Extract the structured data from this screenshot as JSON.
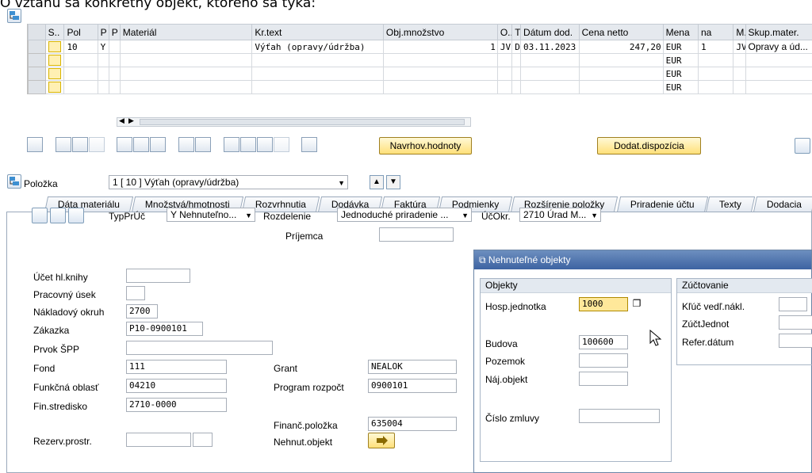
{
  "caption": "O vzťahu sa konkrétny objekt, ktorého sa týka:",
  "grid": {
    "headers": [
      "S..",
      "Pol",
      "P",
      "P",
      "Materiál",
      "Kr.text",
      "Obj.množstvo",
      "O...",
      "T",
      "Dátum dod.",
      "Cena netto",
      "Mena",
      "na",
      "M...",
      "Skup.mater."
    ],
    "rows": [
      {
        "pol": "10",
        "p1": "Y",
        "p2": "",
        "mat": "",
        "kr": "Výťah (opravy/údržba)",
        "qty": "1",
        "o": "JV",
        "t": "D",
        "date": "03.11.2023",
        "price": "247,20",
        "cur": "EUR",
        "na": "1",
        "m": "JV",
        "skup": "Opravy a úd..."
      },
      {
        "pol": "",
        "p1": "",
        "p2": "",
        "mat": "",
        "kr": "",
        "qty": "",
        "o": "",
        "t": "",
        "date": "",
        "price": "",
        "cur": "EUR",
        "na": "",
        "m": "",
        "skup": ""
      },
      {
        "pol": "",
        "p1": "",
        "p2": "",
        "mat": "",
        "kr": "",
        "qty": "",
        "o": "",
        "t": "",
        "date": "",
        "price": "",
        "cur": "EUR",
        "na": "",
        "m": "",
        "skup": ""
      },
      {
        "pol": "",
        "p1": "",
        "p2": "",
        "mat": "",
        "kr": "",
        "qty": "",
        "o": "",
        "t": "",
        "date": "",
        "price": "",
        "cur": "EUR",
        "na": "",
        "m": "",
        "skup": ""
      }
    ]
  },
  "buttons": {
    "navrhov": "Navrhov.hodnoty",
    "dodat": "Dodat.dispozícia"
  },
  "item": {
    "label": "Položka",
    "value": "1 [ 10 ] Výťah (opravy/údržba)"
  },
  "tabs": [
    "Dáta materiálu",
    "Množstvá/hmotnosti",
    "Rozvrhnutia",
    "Dodávka",
    "Faktúra",
    "Podmienky",
    "Rozšírenie položky",
    "Priradenie účtu",
    "Texty",
    "Dodacia"
  ],
  "assign": {
    "typ_label": "TypPrÚč",
    "typ_value": "Y Nehnuteľno...",
    "rozdelenie_label": "Rozdelenie",
    "rozdelenie_value": "Jednoduché priradenie ...",
    "ucokr_label": "ÚčOkr.",
    "ucokr_value": "2710 Úrad M...",
    "prijemca_label": "Príjemca"
  },
  "fields": {
    "ucet": {
      "label": "Účet hl.knihy",
      "value": ""
    },
    "pracovny": {
      "label": "Pracovný úsek",
      "value": ""
    },
    "nakl": {
      "label": "Nákladový okruh",
      "value": "2700"
    },
    "zakazka": {
      "label": "Zákazka",
      "value": "P10-0900101"
    },
    "prvok": {
      "label": "Prvok ŠPP",
      "value": ""
    },
    "fond": {
      "label": "Fond",
      "value": "111"
    },
    "funk": {
      "label": "Funkčná oblasť",
      "value": "04210"
    },
    "fin": {
      "label": "Fin.stredisko",
      "value": "2710-0000"
    },
    "rezerv": {
      "label": "Rezerv.prostr.",
      "value": ""
    },
    "grant": {
      "label": "Grant",
      "value": "NEALOK"
    },
    "program": {
      "label": "Program rozpočt",
      "value": "0900101"
    },
    "financ": {
      "label": "Finanč.položka",
      "value": "635004"
    },
    "nehnut": {
      "label": "Nehnut.objekt"
    }
  },
  "popup": {
    "title": "Nehnuteľné objekty",
    "objekty": "Objekty",
    "hosp_label": "Hosp.jednotka",
    "hosp_value": "1000",
    "budova_label": "Budova",
    "budova_value": "100600",
    "pozemok_label": "Pozemok",
    "naj_label": "Náj.objekt",
    "cislo_label": "Číslo zmluvy",
    "zuctovanie": "Zúčtovanie",
    "kluc_label": "Kľúč vedľ.nákl.",
    "zuct_label": "ZúčtJednot",
    "refer_label": "Refer.dátum"
  },
  "colors": {
    "title_bar": "#3d63a2",
    "highlight": "#ffe07a"
  }
}
